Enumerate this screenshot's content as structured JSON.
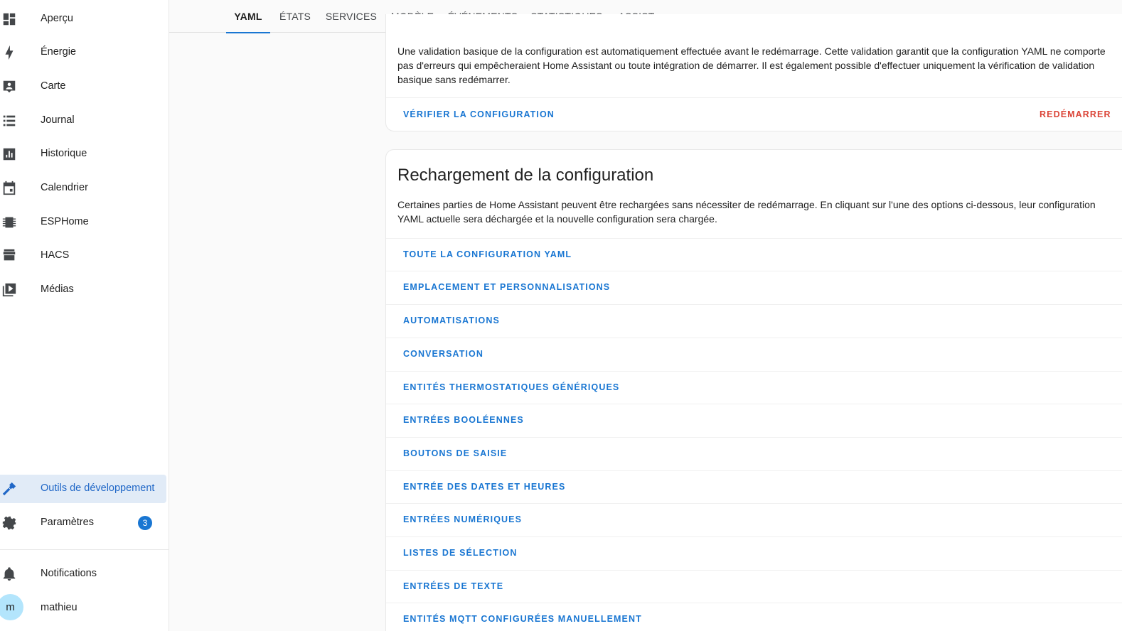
{
  "sidebar": {
    "items": [
      {
        "label": "Aperçu",
        "icon": "dashboard-icon"
      },
      {
        "label": "Énergie",
        "icon": "lightning-icon"
      },
      {
        "label": "Carte",
        "icon": "map-icon"
      },
      {
        "label": "Journal",
        "icon": "list-icon"
      },
      {
        "label": "Historique",
        "icon": "chart-box-icon"
      },
      {
        "label": "Calendrier",
        "icon": "calendar-icon"
      },
      {
        "label": "ESPHome",
        "icon": "chip-icon"
      },
      {
        "label": "HACS",
        "icon": "hacs-icon"
      },
      {
        "label": "Médias",
        "icon": "media-play-icon"
      }
    ],
    "dev_tools": {
      "label": "Outils de développement",
      "icon": "hammer-icon"
    },
    "settings": {
      "label": "Paramètres",
      "icon": "gear-icon",
      "badge": "3"
    },
    "notifications": {
      "label": "Notifications",
      "icon": "bell-icon"
    },
    "user": {
      "label": "mathieu",
      "initial": "m"
    }
  },
  "tabs": [
    "YAML",
    "ÉTATS",
    "SERVICES",
    "MODÈLE",
    "ÉVÉNEMENTS",
    "STATISTIQUES",
    "ASSIST"
  ],
  "active_tab": "YAML",
  "validation_card": {
    "text": "Une validation basique de la configuration est automatiquement effectuée avant le redémarrage. Cette validation garantit que la configuration YAML ne comporte pas d'erreurs qui empêcheraient Home Assistant ou toute intégration de démarrer. Il est également possible d'effectuer uniquement la vérification de validation basique sans redémarrer.",
    "check_label": "VÉRIFIER LA CONFIGURATION",
    "restart_label": "REDÉMARRER"
  },
  "reload_card": {
    "title": "Rechargement de la configuration",
    "text": "Certaines parties de Home Assistant peuvent être rechargées sans nécessiter de redémarrage. En cliquant sur l'une des options ci-dessous, leur configuration YAML actuelle sera déchargée et la nouvelle configuration sera chargée.",
    "items": [
      "TOUTE LA CONFIGURATION YAML",
      "EMPLACEMENT ET PERSONNALISATIONS",
      "AUTOMATISATIONS",
      "CONVERSATION",
      "ENTITÉS THERMOSTATIQUES GÉNÉRIQUES",
      "ENTRÉES BOOLÉENNES",
      "BOUTONS DE SAISIE",
      "ENTRÉE DES DATES ET HEURES",
      "ENTRÉES NUMÉRIQUES",
      "LISTES DE SÉLECTION",
      "ENTRÉES DE TEXTE",
      "ENTITÉS MQTT CONFIGURÉES MANUELLEMENT"
    ]
  },
  "colors": {
    "accent": "#1976d2",
    "danger": "#db4437",
    "active_bg": "#e1ebf7"
  }
}
